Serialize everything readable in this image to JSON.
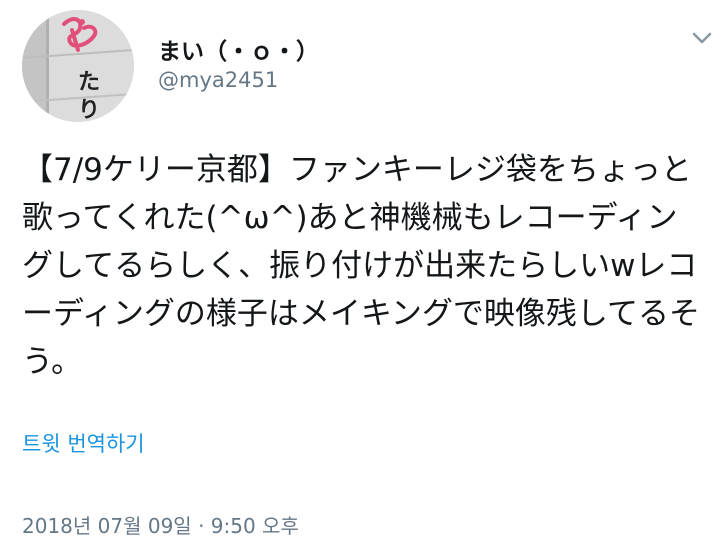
{
  "tweet": {
    "author": {
      "display_name": "まい（・ｏ・）",
      "handle": "@mya2451",
      "avatar": {
        "glyph_1": "た",
        "glyph_2": "り"
      }
    },
    "menu_icon": "chevron-down-icon",
    "text": "【7/9ケリー京都】ファンキーレジ袋をちょっと歌ってくれた(^ω^)あと神機械もレコーディングしてるらしく、振り付けが出来たらしいwレコーディングの様子はメイキングで映像残してるそう。",
    "translate_label": "트윗 번역하기",
    "timestamp": "2018년 07월 09일 · 9:50 오후"
  },
  "colors": {
    "text": "#14171a",
    "secondary": "#657786",
    "link": "#1b95e0"
  }
}
